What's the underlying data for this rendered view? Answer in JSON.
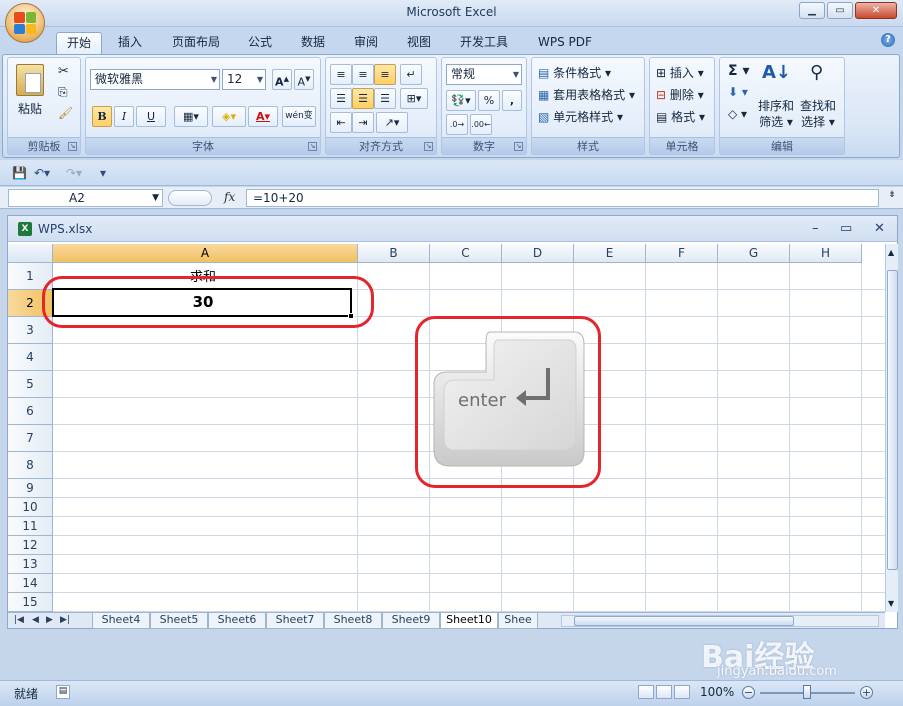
{
  "window": {
    "title": "Microsoft Excel"
  },
  "tabs": [
    "开始",
    "插入",
    "页面布局",
    "公式",
    "数据",
    "审阅",
    "视图",
    "开发工具",
    "WPS PDF"
  ],
  "ribbon": {
    "groups": {
      "clipboard": "剪贴板",
      "font": "字体",
      "alignment": "对齐方式",
      "number": "数字",
      "styles": "样式",
      "cells": "单元格",
      "editing": "编辑"
    },
    "paste_label": "粘贴",
    "font_name": "微软雅黑",
    "font_size": "12",
    "bold": "B",
    "italic": "I",
    "underline": "U",
    "phonetic": "wén变",
    "number_format": "常规",
    "percent": "%",
    "comma": ",",
    "cond_format": "条件格式",
    "table_format": "套用表格格式",
    "cell_style": "单元格样式",
    "insert": "插入",
    "delete": "删除",
    "format": "格式",
    "sort_filter_1": "排序和",
    "sort_filter_2": "筛选",
    "find_select_1": "查找和",
    "find_select_2": "选择"
  },
  "formula_bar": {
    "name_box": "A2",
    "fx": "fx",
    "formula": "=10+20"
  },
  "workbook": {
    "name": "WPS.xlsx"
  },
  "columns": [
    "A",
    "B",
    "C",
    "D",
    "E",
    "F",
    "G",
    "H"
  ],
  "rows": [
    "1",
    "2",
    "3",
    "4",
    "5",
    "6",
    "7",
    "8",
    "9",
    "10",
    "11",
    "12",
    "13",
    "14",
    "15"
  ],
  "cells": {
    "A1": "求和",
    "A2": "30"
  },
  "sheets": [
    "Sheet4",
    "Sheet5",
    "Sheet6",
    "Sheet7",
    "Sheet8",
    "Sheet9",
    "Sheet10",
    "Shee"
  ],
  "active_sheet": "Sheet10",
  "status": {
    "ready": "就绪",
    "zoom": "100%"
  },
  "enter_key_label": "enter",
  "watermark": {
    "brand": "Bai经验",
    "url": "jingyan.baidu.com"
  },
  "colors": {
    "accent": "#e2262b",
    "selected_header": "#f1c15f"
  }
}
